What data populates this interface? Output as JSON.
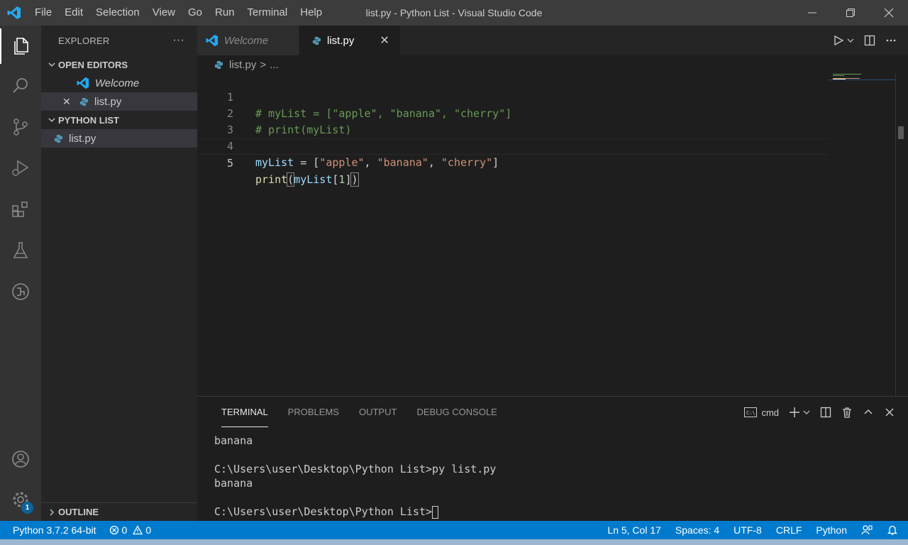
{
  "window": {
    "title": "list.py - Python List - Visual Studio Code",
    "menu": [
      "File",
      "Edit",
      "Selection",
      "View",
      "Go",
      "Run",
      "Terminal",
      "Help"
    ]
  },
  "activity_bar": {
    "items": [
      "explorer-icon",
      "search-icon",
      "source-control-icon",
      "run-debug-icon",
      "extensions-icon",
      "testing-icon",
      "remote-explorer-icon"
    ],
    "bottom": [
      "accounts-icon",
      "manage-gear-icon"
    ],
    "manage_badge": "1"
  },
  "sidebar": {
    "title": "EXPLORER",
    "more": "···",
    "open_editors": {
      "label": "OPEN EDITORS",
      "items": [
        {
          "label": "Welcome",
          "icon": "vscode-icon"
        },
        {
          "label": "list.py",
          "icon": "python-icon",
          "close": "✕"
        }
      ]
    },
    "folder": {
      "label": "PYTHON LIST",
      "items": [
        {
          "label": "list.py",
          "icon": "python-icon"
        }
      ]
    },
    "outline": "OUTLINE"
  },
  "tabs": [
    {
      "label": "Welcome",
      "active": false
    },
    {
      "label": "list.py",
      "active": true,
      "close": "✕"
    }
  ],
  "breadcrumb": {
    "file": "list.py",
    "sep": ">",
    "rest": "..."
  },
  "editor": {
    "line_numbers": [
      "1",
      "2",
      "3",
      "4",
      "5"
    ],
    "line1": "# myList = [\"apple\", \"banana\", \"cherry\"]",
    "line2": "# print(myList)",
    "l4_var": "myList",
    "l4_eq": " = [",
    "l4_s1": "\"apple\"",
    "l4_c1": ", ",
    "l4_s2": "\"banana\"",
    "l4_c2": ", ",
    "l4_s3": "\"cherry\"",
    "l4_end": "]",
    "l5_fn": "print",
    "l5_open": "(",
    "l5_var": "myList",
    "l5_lb": "[",
    "l5_num": "1",
    "l5_rb": "]",
    "l5_close": ")"
  },
  "panel": {
    "tabs": [
      "TERMINAL",
      "PROBLEMS",
      "OUTPUT",
      "DEBUG CONSOLE"
    ],
    "active_tab": "TERMINAL",
    "shell": "cmd",
    "terminal_lines": [
      "banana",
      "",
      "C:\\Users\\user\\Desktop\\Python List>py list.py",
      "banana",
      ""
    ],
    "prompt": "C:\\Users\\user\\Desktop\\Python List>"
  },
  "status": {
    "interpreter": "Python 3.7.2 64-bit",
    "errors": "0",
    "warnings": "0",
    "position": "Ln 5, Col 17",
    "spaces": "Spaces: 4",
    "encoding": "UTF-8",
    "eol": "CRLF",
    "language": "Python"
  },
  "colors": {
    "accent": "#007acc",
    "titlebar": "#3c3c3c",
    "sidebar": "#252526",
    "editor": "#1e1e1e"
  }
}
